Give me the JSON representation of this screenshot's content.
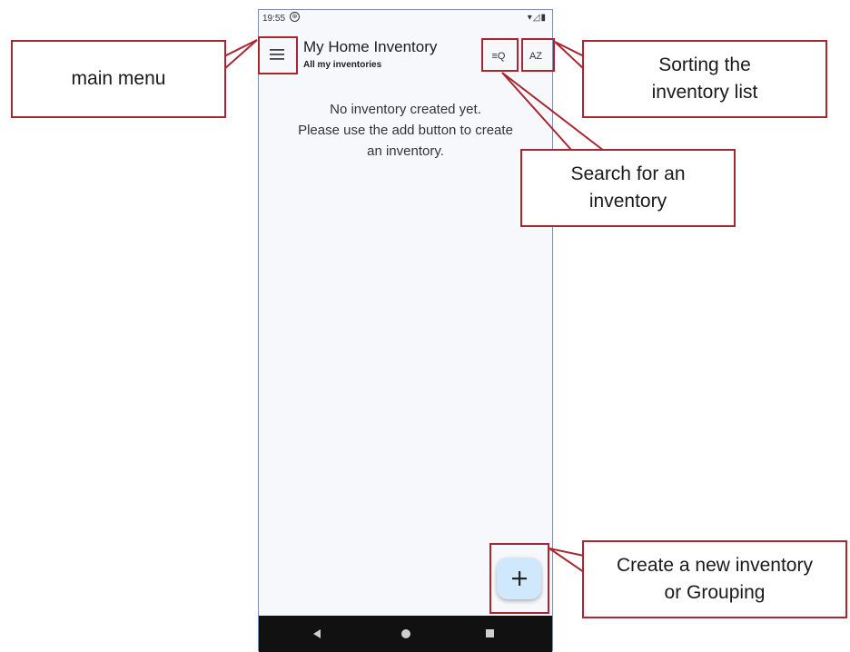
{
  "status_bar": {
    "time": "19:55",
    "notification_glyph": "⊛",
    "system_icons": "▾◿▮"
  },
  "app_bar": {
    "title": "My Home Inventory",
    "subtitle": "All my inventories",
    "search_glyph": "≡Q",
    "sort_glyph": "AZ"
  },
  "empty_state": {
    "line1": "No inventory created yet.",
    "line2": "Please use the add button to create",
    "line3": "an inventory."
  },
  "fab": {
    "glyph": "+"
  },
  "annotations": {
    "main_menu": "main menu",
    "sorting_line1": "Sorting the",
    "sorting_line2": "inventory list",
    "search_line1": "Search for an",
    "search_line2": "inventory",
    "create_line1": "Create a new inventory",
    "create_line2": "or Grouping"
  },
  "colors": {
    "annotation": "#a8262f",
    "fab": "#cfe8fb",
    "nav_bar": "#111111"
  }
}
